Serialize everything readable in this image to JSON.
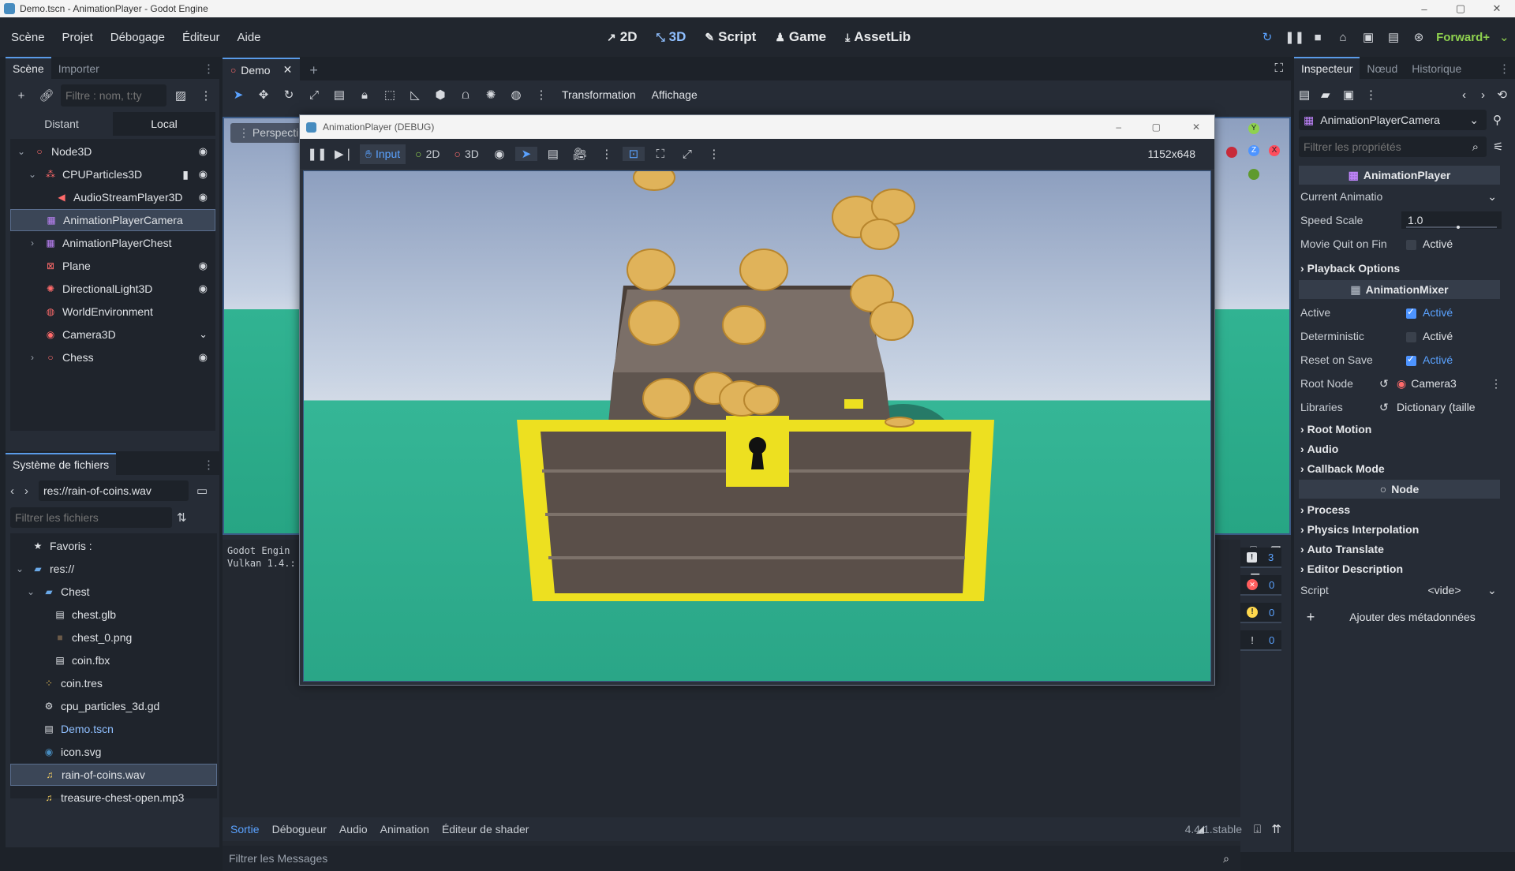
{
  "window": {
    "title": "Demo.tscn - AnimationPlayer - Godot Engine",
    "buttons": [
      "–",
      "▢",
      "✕"
    ]
  },
  "menus": [
    "Scène",
    "Projet",
    "Débogage",
    "Éditeur",
    "Aide"
  ],
  "main_screens": [
    {
      "label": "2D",
      "icon": "2d-icon"
    },
    {
      "label": "3D",
      "icon": "3d-icon"
    },
    {
      "label": "Script",
      "icon": "script-icon"
    },
    {
      "label": "Game",
      "icon": "game-icon"
    },
    {
      "label": "AssetLib",
      "icon": "assetlib-icon"
    }
  ],
  "renderer": "Forward+",
  "scene_dock": {
    "tabs": [
      "Scène",
      "Importer"
    ],
    "filter_placeholder": "Filtre : nom, t:ty",
    "mode_tabs": [
      "Distant",
      "Local"
    ],
    "nodes": [
      {
        "name": "Node3D",
        "depth": 0,
        "arrow": "⌄",
        "icon": "○",
        "color": "#ff6b6b",
        "eye": true
      },
      {
        "name": "CPUParticles3D",
        "depth": 1,
        "arrow": "⌄",
        "icon": "⁂",
        "color": "#ff6b6b",
        "eye": true,
        "script": true
      },
      {
        "name": "AudioStreamPlayer3D",
        "depth": 2,
        "arrow": "",
        "icon": "◀",
        "color": "#ff6b6b",
        "eye": true
      },
      {
        "name": "AnimationPlayerCamera",
        "depth": 1,
        "arrow": "",
        "icon": "▦",
        "color": "#c084fc",
        "eye": false,
        "selected": true
      },
      {
        "name": "AnimationPlayerChest",
        "depth": 1,
        "arrow": "›",
        "icon": "▦",
        "color": "#c084fc",
        "eye": false
      },
      {
        "name": "Plane",
        "depth": 1,
        "arrow": "",
        "icon": "⊠",
        "color": "#ff6b6b",
        "eye": true
      },
      {
        "name": "DirectionalLight3D",
        "depth": 1,
        "arrow": "",
        "icon": "✺",
        "color": "#ff6b6b",
        "eye": true
      },
      {
        "name": "WorldEnvironment",
        "depth": 1,
        "arrow": "",
        "icon": "◍",
        "color": "#ff6b6b",
        "eye": false
      },
      {
        "name": "Camera3D",
        "depth": 1,
        "arrow": "",
        "icon": "◉",
        "color": "#ff6b6b",
        "eye": false,
        "camera": true
      },
      {
        "name": "Chess",
        "depth": 1,
        "arrow": "›",
        "icon": "○",
        "color": "#ff6b6b",
        "eye": true
      }
    ]
  },
  "filesystem": {
    "title": "Système de fichiers",
    "path": "res://rain-of-coins.wav",
    "filter_placeholder": "Filtrer les fichiers",
    "items": [
      {
        "name": "Favoris :",
        "depth": 0,
        "icon": "★",
        "color": "#dfe2e6"
      },
      {
        "name": "res://",
        "depth": 0,
        "icon": "▰",
        "color": "#6aa9e8",
        "arrow": "⌄"
      },
      {
        "name": "Chest",
        "depth": 1,
        "icon": "▰",
        "color": "#6aa9e8",
        "arrow": "⌄"
      },
      {
        "name": "chest.glb",
        "depth": 2,
        "icon": "▤",
        "color": "#dfe2e6"
      },
      {
        "name": "chest_0.png",
        "depth": 2,
        "icon": "■",
        "color": "#6b5a48"
      },
      {
        "name": "coin.fbx",
        "depth": 2,
        "icon": "▤",
        "color": "#dfe2e6"
      },
      {
        "name": "coin.tres",
        "depth": 1,
        "icon": "⁘",
        "color": "#ffcf5a"
      },
      {
        "name": "cpu_particles_3d.gd",
        "depth": 1,
        "icon": "⚙",
        "color": "#dfe2e6"
      },
      {
        "name": "Demo.tscn",
        "depth": 1,
        "icon": "▤",
        "color": "#dfe2e6",
        "link": true
      },
      {
        "name": "icon.svg",
        "depth": 1,
        "icon": "◉",
        "color": "#478cbf"
      },
      {
        "name": "rain-of-coins.wav",
        "depth": 1,
        "icon": "♫",
        "color": "#f7d060",
        "selected": true
      },
      {
        "name": "treasure-chest-open.mp3",
        "depth": 1,
        "icon": "♫",
        "color": "#f7d060"
      }
    ]
  },
  "editor": {
    "tab": "Demo",
    "toolbar_menus": [
      "Transformation",
      "Affichage"
    ],
    "viewport_label": "Perspecti",
    "output_lines": [
      "Godot Engin",
      "Vulkan 1.4.:"
    ],
    "filter_messages": "Filtrer les Messages",
    "bottom_tabs": [
      "Sortie",
      "Débogueur",
      "Audio",
      "Animation",
      "Éditeur de shader"
    ],
    "version": "4.4.1.stable",
    "counters": [
      {
        "icon": "!",
        "value": "3",
        "color": "#ffffff"
      },
      {
        "icon": "✕",
        "value": "0",
        "color": "#ff5d5d"
      },
      {
        "icon": "!",
        "value": "0",
        "color": "#ffd84d"
      },
      {
        "icon": "ǃ",
        "value": "0",
        "color": "#dfe2e6"
      }
    ]
  },
  "debug_window": {
    "title": "AnimationPlayer (DEBUG)",
    "modes": [
      "Input",
      "2D",
      "3D"
    ],
    "resolution": "1152x648"
  },
  "inspector": {
    "tabs": [
      "Inspecteur",
      "Nœud",
      "Historique"
    ],
    "node": "AnimationPlayerCamera",
    "filter_placeholder": "Filtrer les propriétés",
    "cat_player": "AnimationPlayer",
    "rows_player": [
      {
        "label": "Current Animatio",
        "value": "",
        "type": "dropdown"
      },
      {
        "label": "Speed Scale",
        "value": "1.0",
        "type": "slider"
      },
      {
        "label": "Movie Quit on Fin",
        "value": "Activé",
        "type": "check",
        "checked": false
      }
    ],
    "playback": "Playback Options",
    "cat_mixer": "AnimationMixer",
    "rows_mixer": [
      {
        "label": "Active",
        "value": "Activé",
        "type": "check",
        "checked": true
      },
      {
        "label": "Deterministic",
        "value": "Activé",
        "type": "check",
        "checked": false
      },
      {
        "label": "Reset on Save",
        "value": "Activé",
        "type": "check",
        "checked": true
      },
      {
        "label": "Root Node",
        "value": "Camera3",
        "type": "node"
      },
      {
        "label": "Libraries",
        "value": "Dictionary (taille",
        "type": "dict"
      }
    ],
    "sections_mixer": [
      "Root Motion",
      "Audio",
      "Callback Mode"
    ],
    "cat_node": "Node",
    "sections_node": [
      "Process",
      "Physics Interpolation",
      "Auto Translate",
      "Editor Description"
    ],
    "script_label": "Script",
    "script_value": "<vide>",
    "add_meta": "Ajouter des métadonnées"
  }
}
